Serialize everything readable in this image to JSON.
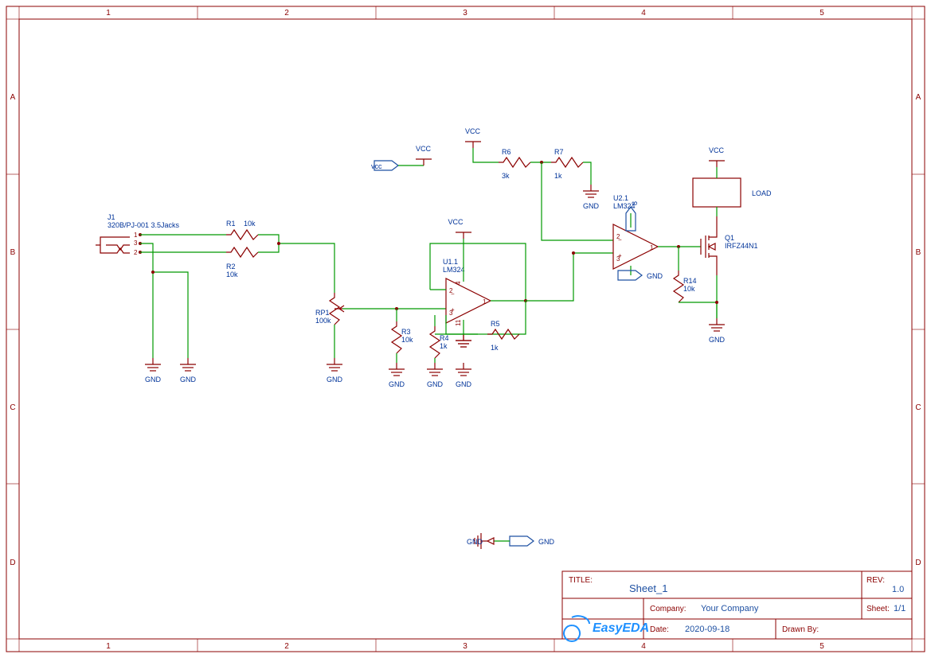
{
  "frame": {
    "cols": [
      "1",
      "2",
      "3",
      "4",
      "5"
    ],
    "rows": [
      "A",
      "B",
      "C",
      "D"
    ]
  },
  "jack": {
    "ref": "J1",
    "val": "320B/PJ-001 3.5Jacks",
    "pins": [
      "1",
      "3",
      "2"
    ]
  },
  "r1": {
    "ref": "R1",
    "val": "10k"
  },
  "r2": {
    "ref": "R2",
    "val": "10k"
  },
  "rp1": {
    "ref": "RP1",
    "val": "100k"
  },
  "r3": {
    "ref": "R3",
    "val": "10k"
  },
  "r4": {
    "ref": "R4",
    "val": "1k"
  },
  "r5": {
    "ref": "R5",
    "val": "1k"
  },
  "r6": {
    "ref": "R6",
    "val": "3k"
  },
  "r7": {
    "ref": "R7",
    "val": "1k"
  },
  "r14": {
    "ref": "R14",
    "val": "10k"
  },
  "u1": {
    "ref": "U1.1",
    "val": "LM324"
  },
  "u2": {
    "ref": "U2.1",
    "val": "LM324"
  },
  "q1": {
    "ref": "Q1",
    "val": "IRFZ44N1"
  },
  "load": "LOAD",
  "vcc": "VCC",
  "gnd": "GND",
  "vcc_net": "vcc",
  "titleblock": {
    "title_lbl": "TITLE:",
    "title": "Sheet_1",
    "rev_lbl": "REV:",
    "rev": "1.0",
    "company_lbl": "Company:",
    "company": "Your Company",
    "sheet_lbl": "Sheet:",
    "sheet": "1/1",
    "date_lbl": "Date:",
    "date": "2020-09-18",
    "drawn_lbl": "Drawn By:",
    "logo": "EasyEDA"
  }
}
